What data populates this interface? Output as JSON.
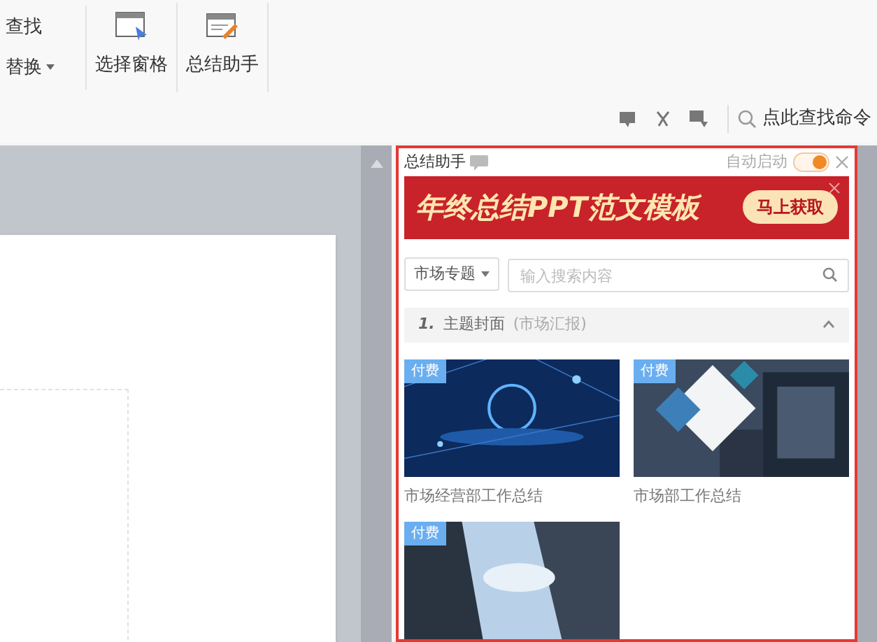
{
  "ribbon": {
    "find_button": "查找",
    "replace_button": "替换",
    "tools": [
      {
        "kind": "pane",
        "label": "选择窗格"
      },
      {
        "kind": "summary",
        "label": "总结助手"
      }
    ]
  },
  "command_search": {
    "placeholder": "点此查找命令"
  },
  "panel": {
    "title": "总结助手",
    "auto_start": {
      "label": "自动启动",
      "on": true
    },
    "banner": {
      "headline": "年终总结PPT范文模板",
      "button": "马上获取"
    },
    "category": "市场专题",
    "search": {
      "placeholder": "输入搜索内容"
    },
    "section": {
      "number": "1.",
      "title": "主题封面",
      "subtitle": "(市场汇报)",
      "expanded": true
    },
    "templates": [
      {
        "badge": "付费",
        "caption": "市场经营部工作总结",
        "kind": "tech"
      },
      {
        "badge": "付费",
        "caption": "市场部工作总结",
        "kind": "building"
      },
      {
        "badge": "付费",
        "kind": "sky"
      }
    ]
  }
}
